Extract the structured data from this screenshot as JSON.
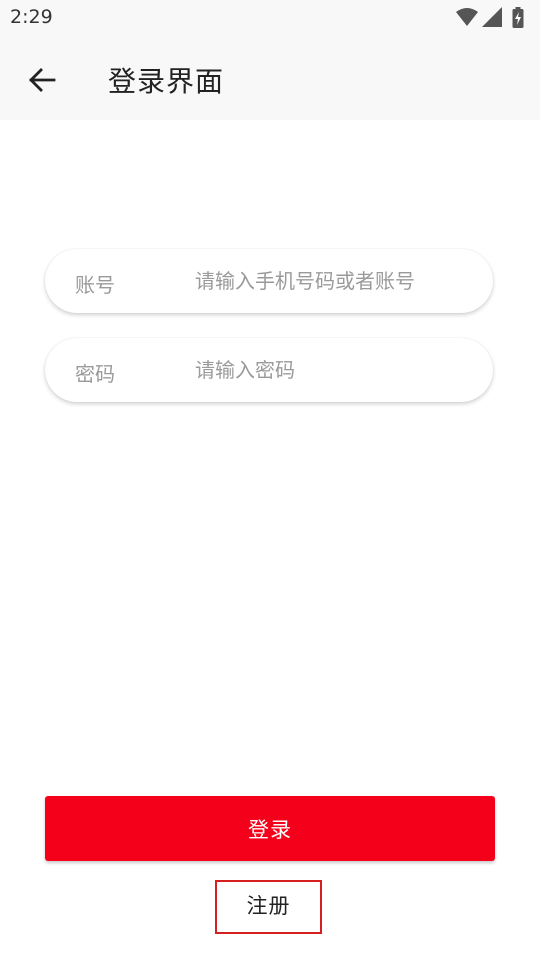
{
  "status_bar": {
    "time": "2:29",
    "icons": [
      "wifi-icon",
      "cell-signal-icon",
      "battery-charging-icon"
    ]
  },
  "app_bar": {
    "back_icon": "arrow-left-icon",
    "title": "登录界面"
  },
  "form": {
    "account": {
      "label": "账号",
      "value": "",
      "placeholder": "请输入手机号码或者账号"
    },
    "password": {
      "label": "密码",
      "value": "",
      "placeholder": "请输入密码"
    }
  },
  "actions": {
    "login_label": "登录",
    "register_label": "注册"
  },
  "colors": {
    "primary": "#f5001a",
    "register_border": "#d42020",
    "bar_background": "#f8f8f8",
    "placeholder_text": "#9a9a9a"
  }
}
